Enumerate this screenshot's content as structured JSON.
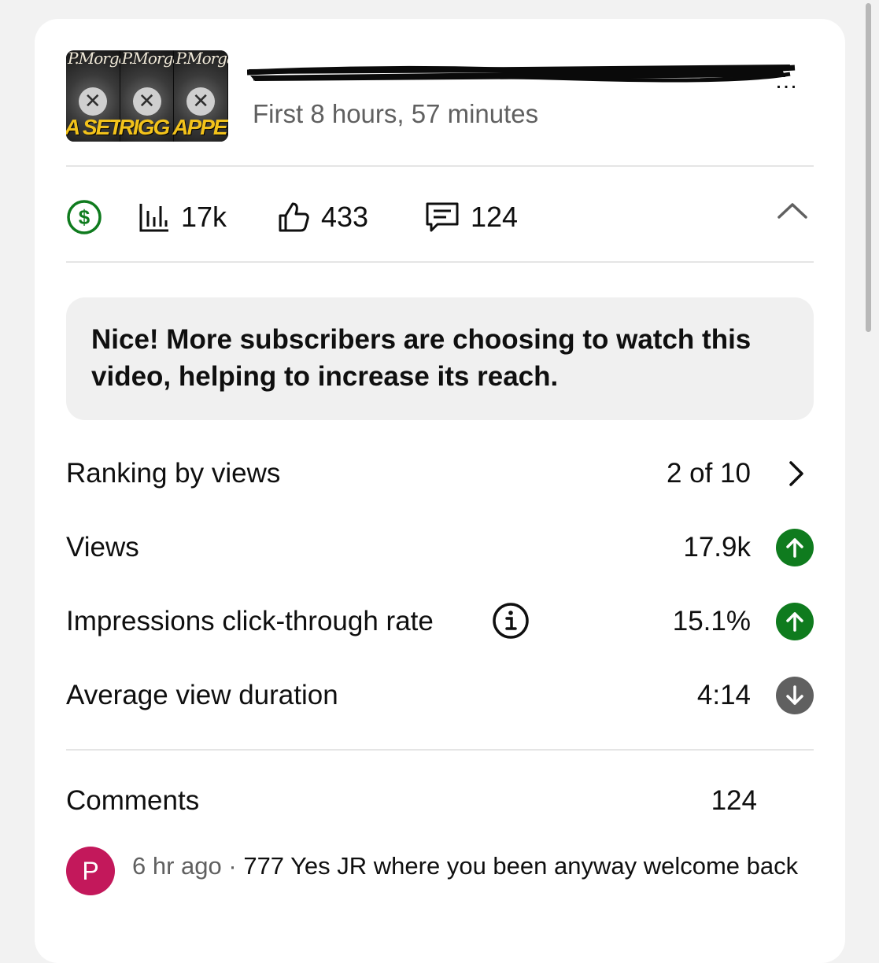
{
  "video": {
    "thumbnail": {
      "panels": [
        {
          "brand": "P.Morga",
          "caption": "A SET"
        },
        {
          "brand": "P.Morga",
          "caption": "RIGG"
        },
        {
          "brand": "P.Morga",
          "caption": "APPE"
        }
      ]
    },
    "title_ellipsis": "…",
    "subtitle": "First 8 hours, 57 minutes"
  },
  "stats": {
    "views": "17k",
    "likes": "433",
    "comments": "124",
    "monetization_icon": "dollar-circle-icon"
  },
  "notice": {
    "text": "Nice! More subscribers are choosing to watch this video, helping to increase its reach."
  },
  "metrics": [
    {
      "label": "Ranking by views",
      "value": "2 of 10",
      "indicator": "chevron-right-icon"
    },
    {
      "label": "Views",
      "value": "17.9k",
      "indicator": "trend-up-icon",
      "color": "#0f7b1e"
    },
    {
      "label": "Impressions click-through rate",
      "value": "15.1%",
      "indicator": "trend-up-icon",
      "color": "#0f7b1e"
    },
    {
      "label": "Average view duration",
      "value": "4:14",
      "indicator": "trend-down-icon",
      "color": "#606060"
    }
  ],
  "comments_section": {
    "label": "Comments",
    "count": "124",
    "latest": {
      "avatar_letter": "P",
      "avatar_color": "#c3185b",
      "time": "6 hr ago",
      "separator": " · ",
      "text": "777 Yes JR where you been anyway welcome back"
    }
  },
  "colors": {
    "positive": "#0f7b1e",
    "neutral": "#606060",
    "monetization": "#0f7b1e"
  }
}
